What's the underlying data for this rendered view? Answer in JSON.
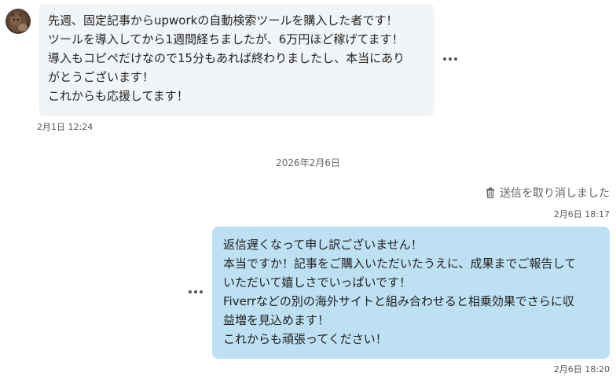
{
  "messages": {
    "incoming": {
      "lines": [
        "先週、固定記事からupworkの自動検索ツールを購入した者です！",
        "ツールを導入してから1週間経ちましたが、6万円ほど稼げてます！",
        "導入もコピペだけなので15分もあれば終わりましたし、本当にあり",
        "がとうございます！",
        "これからも応援してます！"
      ],
      "timestamp": "2月1日 12:24"
    },
    "date_divider": "2026年2月6日",
    "recalled": {
      "label": "送信を取り消しました",
      "timestamp": "2月6日 18:17"
    },
    "outgoing": {
      "lines": [
        "返信遅くなって申し訳ございません！",
        "本当ですか！記事をご購入いただいたうえに、成果までご報告して",
        "いただいて嬉しさでいっぱいです！",
        "Fiverrなどの別の海外サイトと組み合わせると相乗効果でさらに収",
        "益増を見込めます！",
        "これからも頑張ってください！"
      ],
      "timestamp": "2月6日 18:20"
    }
  },
  "icons": {
    "avatar": "avatar",
    "more": "more-options-icon",
    "trash": "trash-icon"
  },
  "colors": {
    "incoming_bubble": "#f2f5f8",
    "outgoing_bubble": "#bde0f3"
  }
}
